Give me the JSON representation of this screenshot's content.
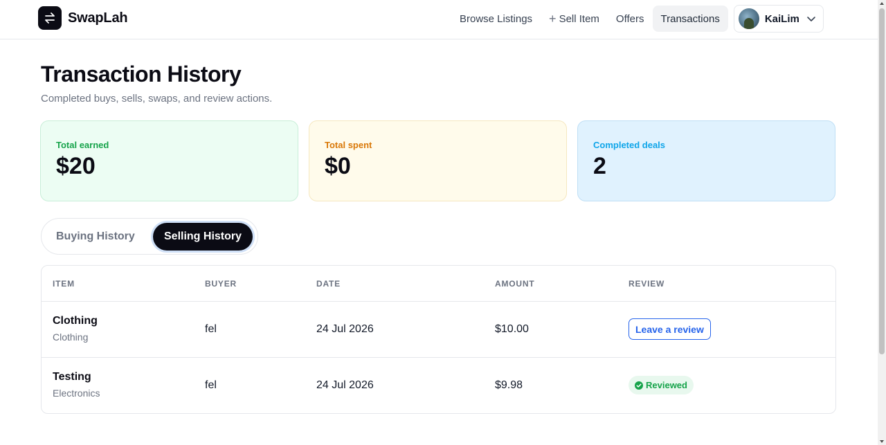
{
  "brand": {
    "name": "SwapLah"
  },
  "nav": {
    "browse": "Browse Listings",
    "sell": "Sell Item",
    "offers": "Offers",
    "transactions": "Transactions",
    "username": "KaiLim"
  },
  "header": {
    "title": "Transaction History",
    "subtitle": "Completed buys, sells, swaps, and review actions."
  },
  "stats": {
    "earned": {
      "label": "Total earned",
      "value": "$20"
    },
    "spent": {
      "label": "Total spent",
      "value": "$0"
    },
    "deals": {
      "label": "Completed deals",
      "value": "2"
    }
  },
  "tabs": {
    "buying": "Buying History",
    "selling": "Selling History",
    "active": "selling"
  },
  "table": {
    "headers": [
      "ITEM",
      "BUYER",
      "DATE",
      "AMOUNT",
      "REVIEW"
    ],
    "rows": [
      {
        "item": "Clothing",
        "category": "Clothing",
        "buyer": "fel",
        "date": "24 Jul 2026",
        "amount": "$10.00",
        "review": "Leave a review",
        "review_state": "pending"
      },
      {
        "item": "Testing",
        "category": "Electronics",
        "buyer": "fel",
        "date": "24 Jul 2026",
        "amount": "$9.98",
        "review": "Reviewed",
        "review_state": "done"
      }
    ]
  },
  "colors": {
    "brand_dark": "#0b0b14",
    "link_blue": "#2563eb",
    "success_green": "#16a34a",
    "warning_amber": "#d97706",
    "info_blue": "#0ea5e9"
  },
  "icons": {
    "logo": "swap-arrows-icon",
    "sell": "plus-icon",
    "user_menu": "chevron-down-icon",
    "reviewed": "check-circle-icon"
  }
}
